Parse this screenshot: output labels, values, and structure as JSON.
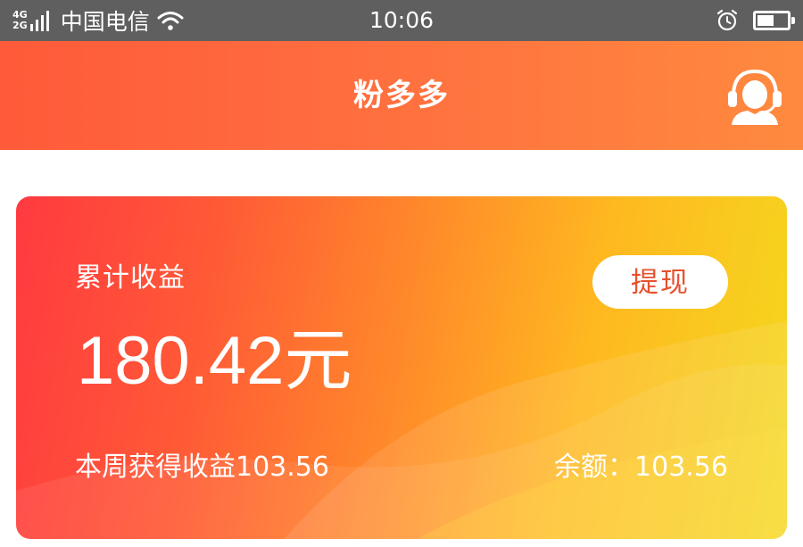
{
  "status_bar": {
    "network_top": "4G",
    "network_bottom": "2G",
    "carrier": "中国电信",
    "time": "10:06",
    "battery_level": 0.55,
    "icons": [
      "signal-icon",
      "wifi-icon",
      "alarm-icon",
      "battery-icon"
    ]
  },
  "header": {
    "title": "粉多多",
    "support_icon": "customer-service-headset-icon"
  },
  "card": {
    "label": "累计收益",
    "withdraw_label": "提现",
    "total_amount": "180.42元",
    "weekly_earnings": "本周获得收益103.56",
    "balance": "余额：103.56"
  },
  "colors": {
    "status_bar_bg": "#5f5f5f",
    "header_gradient_start": "#ff5a3a",
    "header_gradient_end": "#ff8a3f",
    "card_gradient_start": "#ff3a40",
    "card_gradient_end": "#f4d81e",
    "withdraw_text": "#e8502e"
  }
}
